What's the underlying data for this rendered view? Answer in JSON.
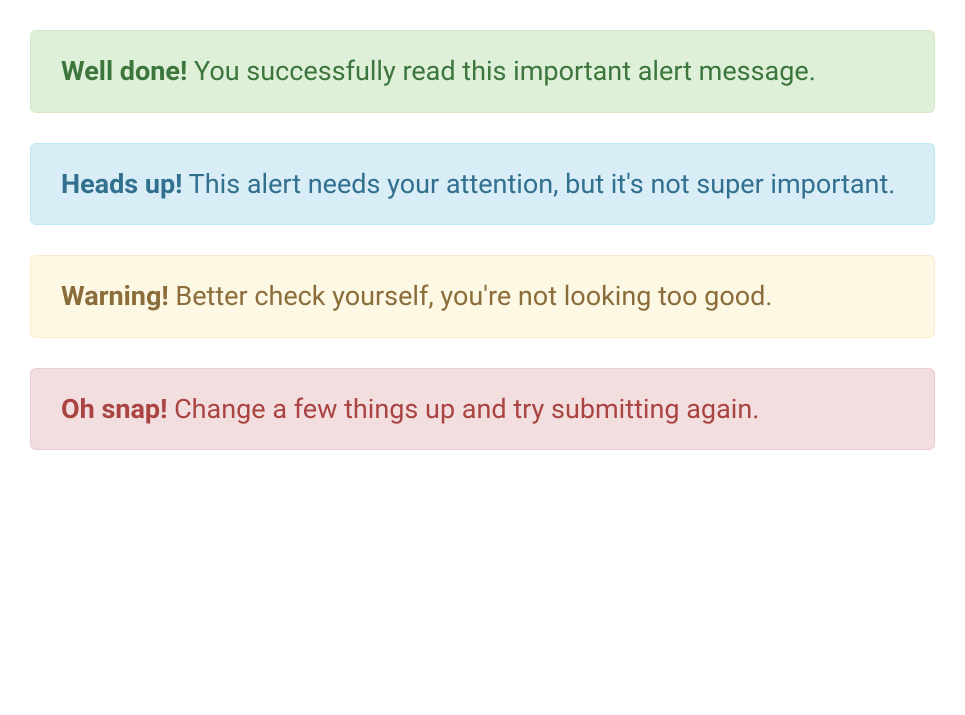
{
  "alerts": [
    {
      "type": "success",
      "title": "Well done!",
      "message": " You successfully read this important alert message."
    },
    {
      "type": "info",
      "title": "Heads up!",
      "message": " This alert needs your attention, but it's not super important."
    },
    {
      "type": "warning",
      "title": "Warning!",
      "message": " Better check yourself, you're not looking too good."
    },
    {
      "type": "danger",
      "title": "Oh snap!",
      "message": " Change a few things up and try submitting again."
    }
  ]
}
